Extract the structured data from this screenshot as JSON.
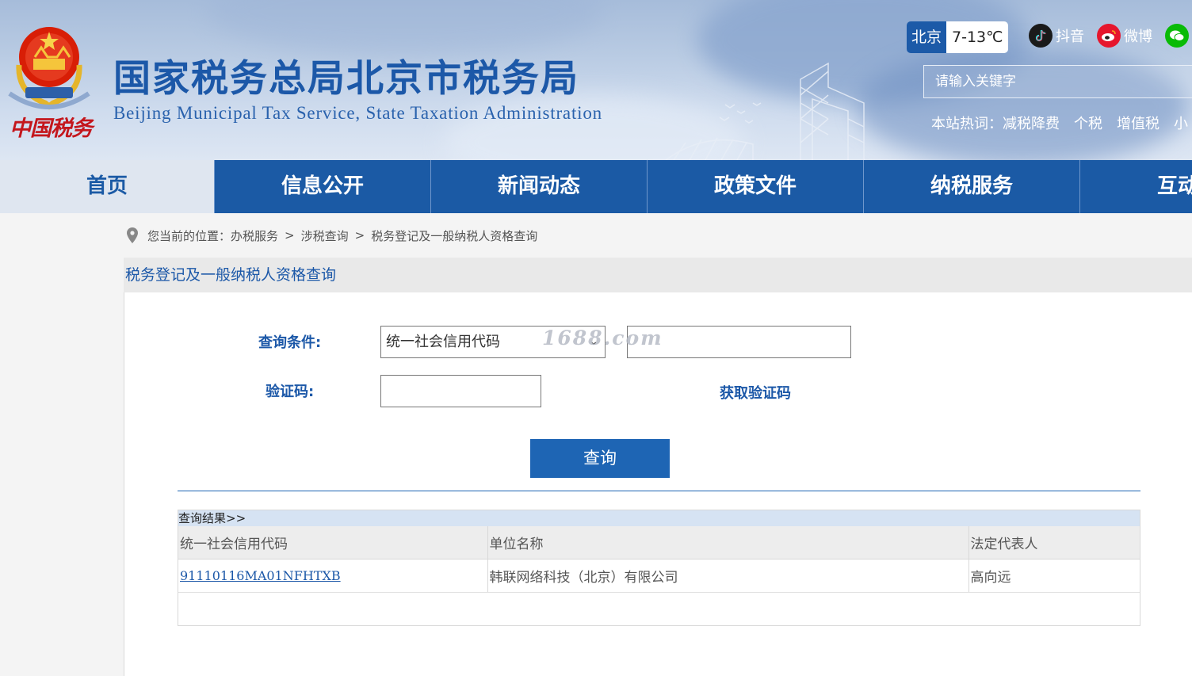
{
  "header": {
    "title": "国家税务总局北京市税务局",
    "subtitle": "Beijing Municipal Tax Service, State Taxation Administration",
    "seal_text": "中国税务",
    "weather": {
      "city": "北京",
      "temp": "7-13℃"
    },
    "social": [
      {
        "label": "抖音",
        "icon": "douyin-icon",
        "color": "#1a1a1a"
      },
      {
        "label": "微博",
        "icon": "weibo-icon",
        "color": "#e6162d"
      },
      {
        "label": "",
        "icon": "wechat-icon",
        "color": "#09bb07"
      }
    ],
    "search_placeholder": "请输入关键字",
    "hot": {
      "label": "本站热词：",
      "words": [
        "减税降费",
        "个税",
        "增值税",
        "小"
      ]
    }
  },
  "nav": {
    "items": [
      {
        "label": "首页",
        "active": true
      },
      {
        "label": "信息公开"
      },
      {
        "label": "新闻动态"
      },
      {
        "label": "政策文件"
      },
      {
        "label": "纳税服务"
      },
      {
        "label": "互动交"
      }
    ]
  },
  "breadcrumb": {
    "prefix": "您当前的位置：",
    "items": [
      "办税服务",
      "涉税查询",
      "税务登记及一般纳税人资格查询"
    ],
    "separator": ">"
  },
  "page_title": "税务登记及一般纳税人资格查询",
  "form": {
    "query_label": "查询条件:",
    "select_value": "统一社会信用代码",
    "query_value": "",
    "captcha_label": "验证码:",
    "captcha_value": "",
    "get_code": "获取验证码",
    "submit": "查询",
    "watermark": "1688.com"
  },
  "results": {
    "heading": "查询结果>>",
    "columns": [
      "统一社会信用代码",
      "单位名称",
      "法定代表人"
    ],
    "rows": [
      [
        "91110116MA01NFHTXB",
        "韩联网络科技（北京）有限公司",
        "高向远"
      ]
    ]
  },
  "colors": {
    "primary": "#1b5aa5",
    "link": "#1c58a8",
    "seal_red": "#c4161c"
  }
}
